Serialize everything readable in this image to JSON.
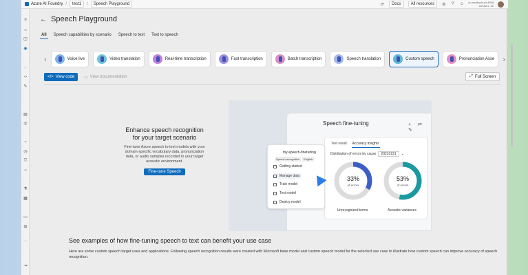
{
  "topbar": {
    "brand": "Azure AI Foundry",
    "project": "test1",
    "page": "Speech Playground",
    "docs": "Docs",
    "resources": "All resources",
    "user_line1": "ai-wwabuxhuei-4698",
    "user_line2": "westus1, 30"
  },
  "page": {
    "back_icon": "arrow-left-icon",
    "title": "Speech Playground"
  },
  "filter_tabs": [
    {
      "label": "All",
      "active": true
    },
    {
      "label": "Speech capabilities by scenario",
      "active": false
    },
    {
      "label": "Speech to text",
      "active": false
    },
    {
      "label": "Text to speech",
      "active": false
    }
  ],
  "capabilities": [
    {
      "label": "Voice live",
      "color": "#7fb3e8"
    },
    {
      "label": "Video translation",
      "color": "#6fc4d8"
    },
    {
      "label": "Real-time transcription",
      "color": "#c07fd8"
    },
    {
      "label": "Fast transcription",
      "color": "#9c8fe0"
    },
    {
      "label": "Batch transcription",
      "color": "#d88fc7"
    },
    {
      "label": "Speech translation",
      "color": "#a3b8e8"
    },
    {
      "label": "Custom speech",
      "color": "#5fb8d8",
      "selected": true
    },
    {
      "label": "Pronunciation Asse",
      "color": "#e48fc0"
    }
  ],
  "toolbar": {
    "view_code": "View code",
    "view_docs": "View documentation",
    "full_screen": "Full Screen"
  },
  "hero": {
    "title": "Enhance speech recognition for your target scenario",
    "description": "Fine-tune Azure speech to text models with your domain-specific vocabulary data, pronunciation data, or audio samples recorded in your target acoustic environment.",
    "button": "Fine-tune Speech"
  },
  "illustration": {
    "title": "Speech fine-tuning",
    "tabs": [
      "Test result",
      "Accuracy insights"
    ],
    "distribution_label": "Distribution of errors by cause",
    "distribution_value": "20210221",
    "panel_title": "my-speech-finetuning",
    "panel_chips": [
      "Speech recognition",
      "English"
    ],
    "steps": [
      "Getting started",
      "Manage data",
      "Train model",
      "Test model",
      "Deploy model"
    ],
    "donut1": {
      "percent": 33,
      "pct_text": "33%",
      "sub": "of errors",
      "label": "Unrecognized terms",
      "color": "#3b5fc4"
    },
    "donut2": {
      "percent": 53,
      "pct_text": "53%",
      "sub": "of errors",
      "label": "Acoustic variances",
      "color": "#1a9aa0"
    }
  },
  "examples": {
    "title": "See examples of how fine-tuning speech to text can benefit your use case",
    "description": "Here are some custom speech target uses and applications. Following speech recognition results were created with Microsoft base model and custom speech model for the selected use case to illustrate how custom speech can improve accuracy of speech recognition."
  }
}
